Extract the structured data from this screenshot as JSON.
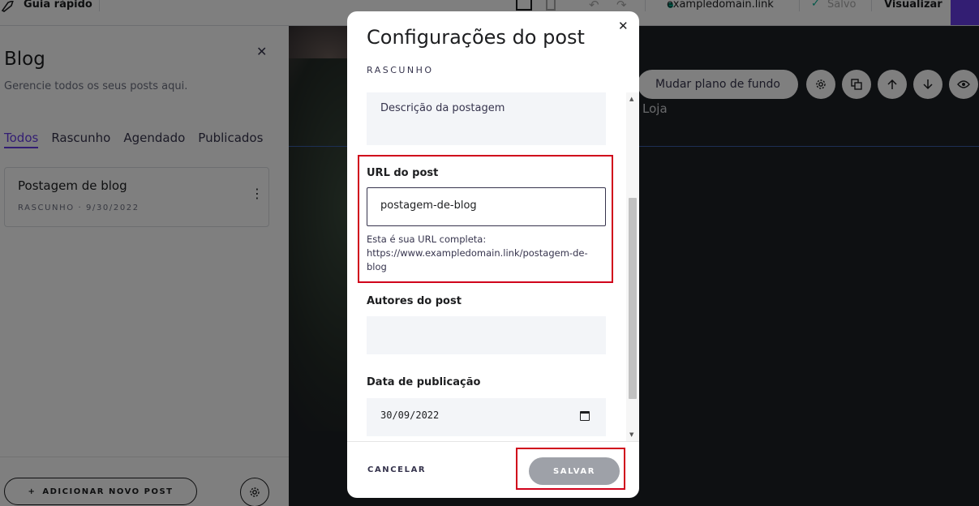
{
  "topbar": {
    "guide_label": "Guia rápido",
    "domain": "exampledomain.link",
    "saved_label": "Salvo",
    "preview_label": "Visualizar"
  },
  "blog_panel": {
    "title": "Blog",
    "subtitle": "Gerencie todos os seus posts aqui.",
    "tabs": [
      "Todos",
      "Rascunho",
      "Agendado",
      "Publicados"
    ],
    "active_tab": "Todos",
    "posts": [
      {
        "title": "Postagem de blog",
        "meta": "RASCUNHO · 9/30/2022"
      }
    ],
    "add_post_label": "ADICIONAR NOVO POST"
  },
  "canvas": {
    "change_bg_label": "Mudar plano de fundo",
    "nav_item": "Loja",
    "icons": [
      "gear-icon",
      "duplicate-icon",
      "arrow-up-icon",
      "arrow-down-icon",
      "eye-icon"
    ]
  },
  "modal": {
    "title": "Configurações do post",
    "status": "RASCUNHO",
    "description_placeholder": "Descrição da postagem",
    "url_label": "URL do post",
    "url_value": "postagem-de-blog",
    "url_help_line1": "Esta é sua URL completa:",
    "url_help_line2": "https://www.exampledomain.link/postagem-de-blog",
    "authors_label": "Autores do post",
    "authors_value": "",
    "date_label": "Data de publicação",
    "date_value": "30/09/2022",
    "cancel_label": "CANCELAR",
    "save_label": "SALVAR"
  },
  "colors": {
    "accent": "#673de6",
    "highlight": "#d0021b",
    "save_button": "#9ea1a8",
    "field_bg": "#f3f5f8"
  }
}
